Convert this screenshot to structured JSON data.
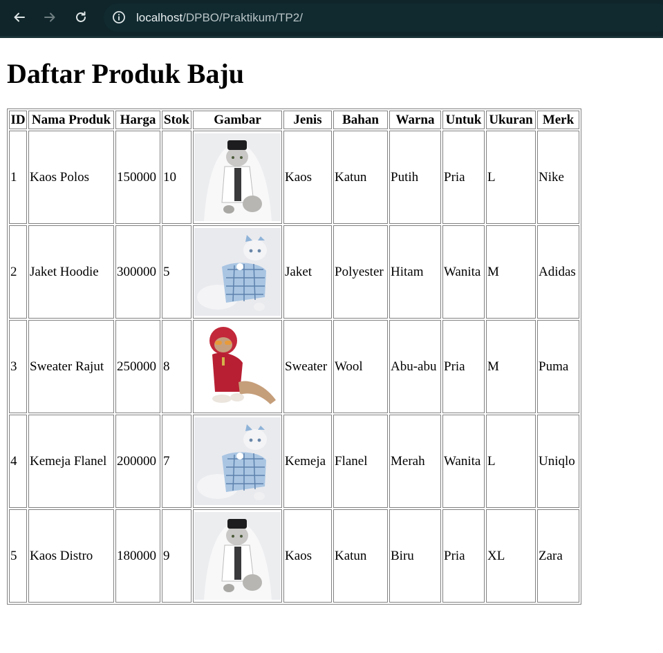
{
  "browser": {
    "url_host": "localhost",
    "url_path": "/DPBO/Praktikum/TP2/"
  },
  "page": {
    "title": "Daftar Produk Baju"
  },
  "table": {
    "headers": {
      "id": "ID",
      "nama": "Nama Produk",
      "harga": "Harga",
      "stok": "Stok",
      "gambar": "Gambar",
      "jenis": "Jenis",
      "bahan": "Bahan",
      "warna": "Warna",
      "untuk": "Untuk",
      "ukuran": "Ukuran",
      "merk": "Merk"
    },
    "rows": [
      {
        "id": "1",
        "nama": "Kaos Polos",
        "harga": "150000",
        "stok": "10",
        "image": "cat-in-white-shirt-and-black-cap",
        "jenis": "Kaos",
        "bahan": "Katun",
        "warna": "Putih",
        "untuk": "Pria",
        "ukuran": "L",
        "merk": "Nike"
      },
      {
        "id": "2",
        "nama": "Jaket Hoodie",
        "harga": "300000",
        "stok": "5",
        "image": "cat-in-blue-plaid-dress",
        "jenis": "Jaket",
        "bahan": "Polyester",
        "warna": "Hitam",
        "untuk": "Wanita",
        "ukuran": "M",
        "merk": "Adidas"
      },
      {
        "id": "3",
        "nama": "Sweater Rajut",
        "harga": "250000",
        "stok": "8",
        "image": "cat-in-red-hoodie-with-sunglasses",
        "jenis": "Sweater",
        "bahan": "Wool",
        "warna": "Abu-abu",
        "untuk": "Pria",
        "ukuran": "M",
        "merk": "Puma"
      },
      {
        "id": "4",
        "nama": "Kemeja Flanel",
        "harga": "200000",
        "stok": "7",
        "image": "cat-in-blue-plaid-dress",
        "jenis": "Kemeja",
        "bahan": "Flanel",
        "warna": "Merah",
        "untuk": "Wanita",
        "ukuran": "L",
        "merk": "Uniqlo"
      },
      {
        "id": "5",
        "nama": "Kaos Distro",
        "harga": "180000",
        "stok": "9",
        "image": "cat-in-white-shirt-and-black-cap",
        "jenis": "Kaos",
        "bahan": "Katun",
        "warna": "Biru",
        "untuk": "Pria",
        "ukuran": "XL",
        "merk": "Zara"
      }
    ]
  }
}
